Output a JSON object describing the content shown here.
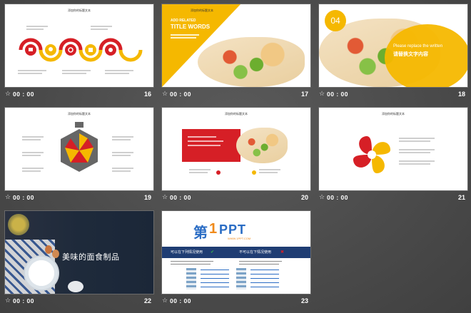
{
  "slides": [
    {
      "number": "16",
      "time": "00 : 00",
      "title": "添加你的标题文本"
    },
    {
      "number": "17",
      "time": "00 : 00",
      "title": "添加你的标题文本",
      "heading_small": "ADD RELATED",
      "heading_big": "TITLE WORDS"
    },
    {
      "number": "18",
      "time": "00 : 00",
      "badge": "04",
      "caption_en": "Please replace the written",
      "caption_cn": "请替换文字内容"
    },
    {
      "number": "19",
      "time": "00 : 00",
      "title": "添加你的标题文本"
    },
    {
      "number": "20",
      "time": "00 : 00",
      "title": "添加你的标题文本"
    },
    {
      "number": "21",
      "time": "00 : 00",
      "title": "添加你的标题文本"
    },
    {
      "number": "22",
      "time": "00 : 00",
      "caption": "美味的面食制品"
    },
    {
      "number": "23",
      "time": "00 : 00",
      "logo_cn": "第",
      "logo_num": "1",
      "logo_en": "PPT",
      "logo_sub": "WWW.1PPT.COM",
      "left_head": "可以在下列情况使用",
      "right_head": "不可以在下情况使用"
    }
  ],
  "colors": {
    "yellow": "#f5b800",
    "red": "#d61f26",
    "navy": "#1f3d73"
  }
}
